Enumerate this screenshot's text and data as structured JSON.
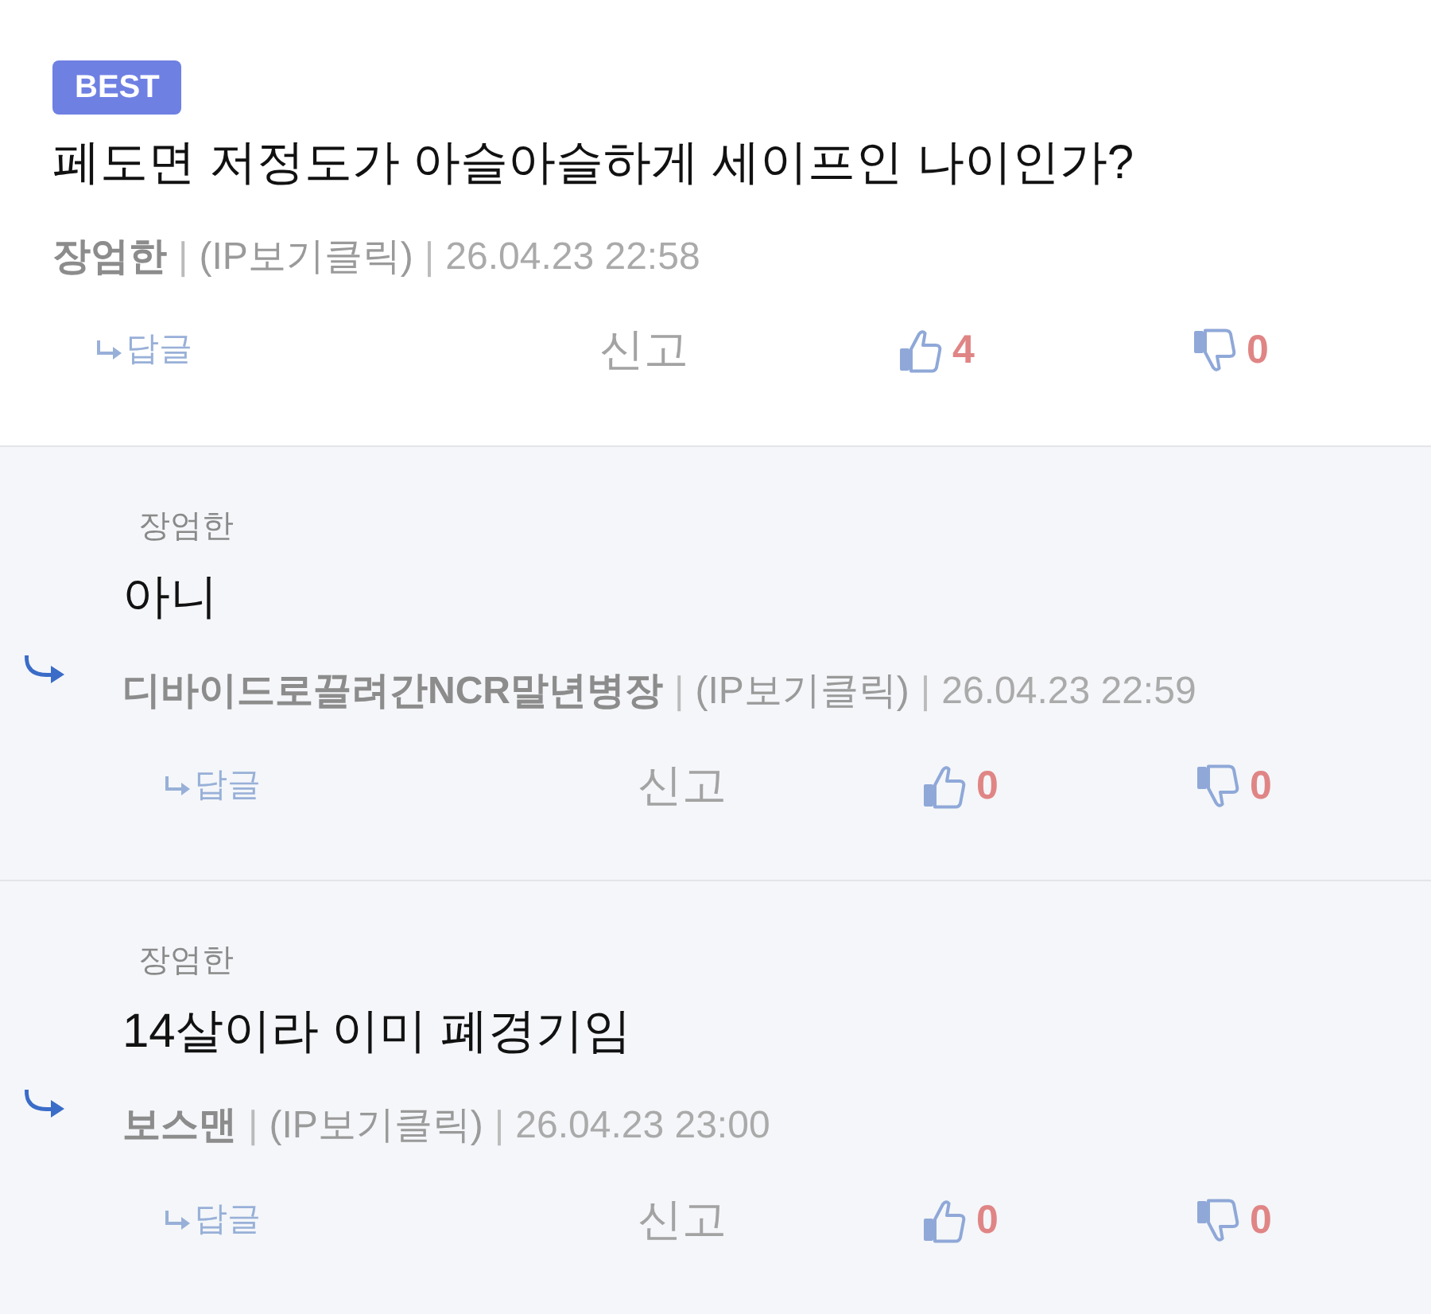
{
  "comments": [
    {
      "kind": "best",
      "badge": "BEST",
      "content": "페도면 저정도가 아슬아슬하게 세이프인 나이인가?",
      "meta": [
        {
          "kind": "author",
          "text": "장엄한"
        },
        {
          "kind": "separator",
          "text": "|"
        },
        {
          "kind": "ip",
          "text": "(IP보기클릭)"
        },
        {
          "kind": "separator",
          "text": "|"
        },
        {
          "kind": "date",
          "text": "26.04.23 22:58"
        }
      ],
      "actions": {
        "reply": "답글",
        "report": "신고",
        "likes": "4",
        "dislikes": "0"
      }
    },
    {
      "kind": "reply",
      "reply_to": "장엄한",
      "content": "아니",
      "meta": [
        {
          "kind": "author",
          "text": "디바이드로끌려간NCR말년병장"
        },
        {
          "kind": "separator",
          "text": "|"
        },
        {
          "kind": "ip",
          "text": "(IP보기클릭)"
        },
        {
          "kind": "separator",
          "text": "|"
        },
        {
          "kind": "date",
          "text": "26.04.23 22:59"
        }
      ],
      "actions": {
        "reply": "답글",
        "report": "신고",
        "likes": "0",
        "dislikes": "0"
      }
    },
    {
      "kind": "reply",
      "reply_to": "장엄한",
      "content": "14살이라 이미 폐경기임",
      "meta": [
        {
          "kind": "author",
          "text": "보스맨"
        },
        {
          "kind": "separator",
          "text": "|"
        },
        {
          "kind": "ip",
          "text": "(IP보기클릭)"
        },
        {
          "kind": "separator",
          "text": "|"
        },
        {
          "kind": "date",
          "text": "26.04.23 23:00"
        }
      ],
      "actions": {
        "reply": "답글",
        "report": "신고",
        "likes": "0",
        "dislikes": "0"
      }
    }
  ]
}
